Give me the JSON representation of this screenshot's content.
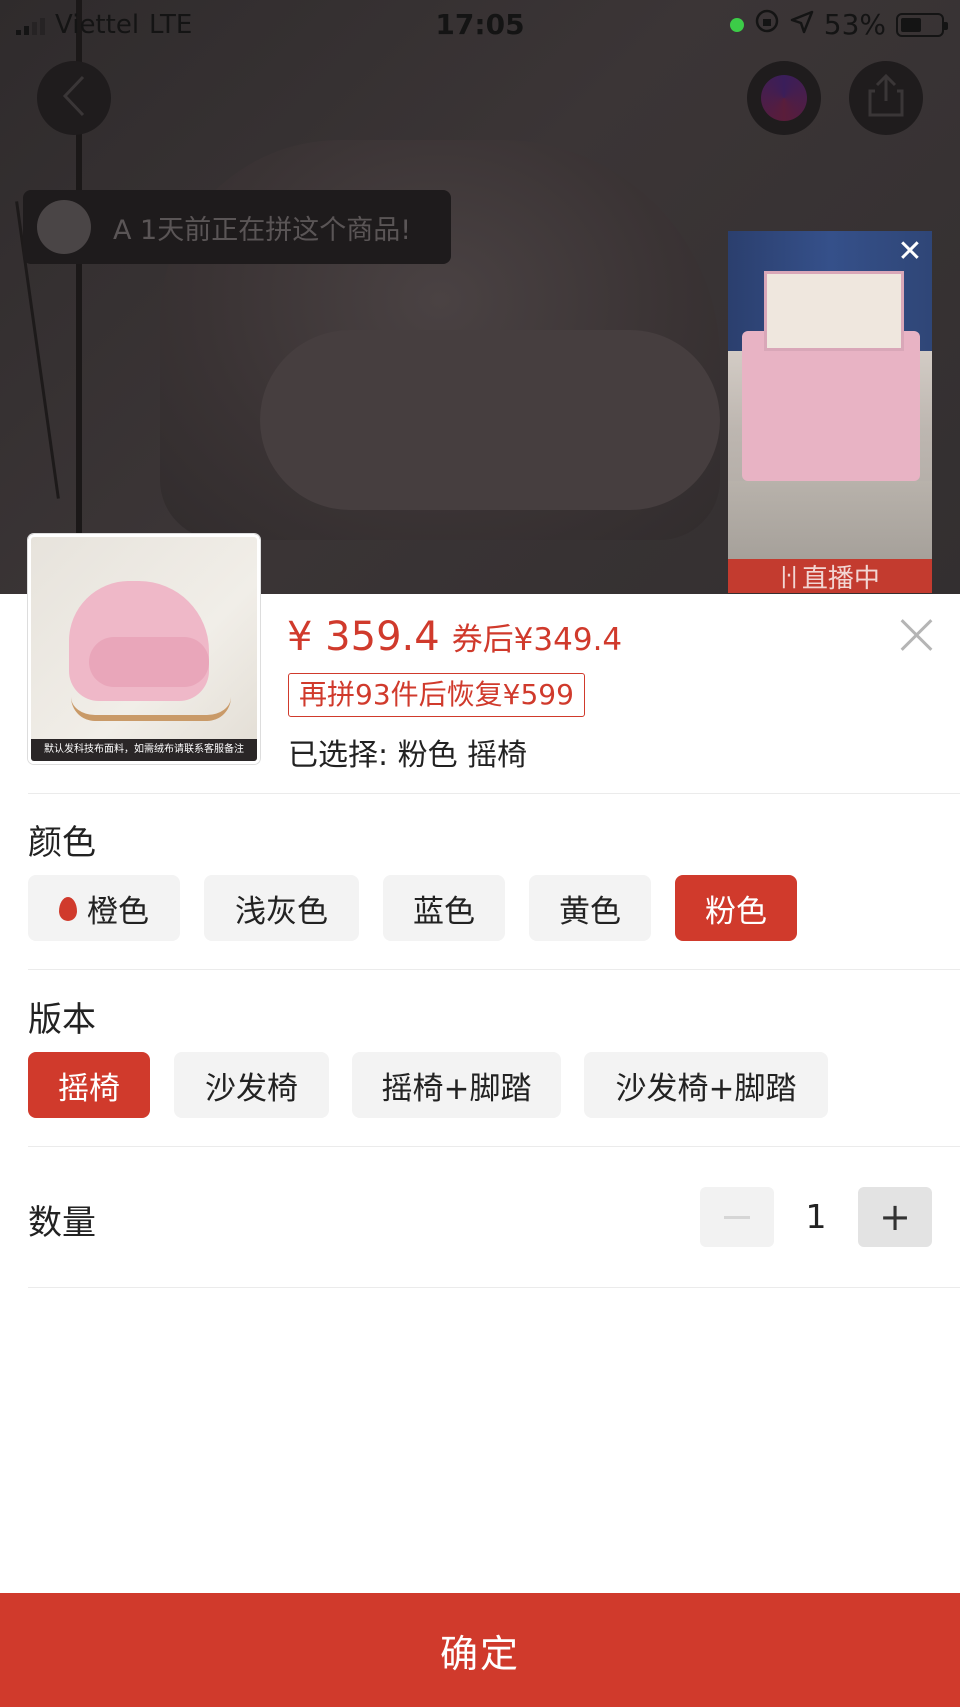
{
  "status_bar": {
    "carrier": "Viettel",
    "network": "LTE",
    "time": "17:05",
    "battery_percent": "53%",
    "battery_level": 0.53
  },
  "icons": {
    "back": "chevron-left-icon",
    "share": "share-icon",
    "close": "close-icon",
    "flame": "flame-icon"
  },
  "notice": {
    "text": "A 1天前正在拼这个商品!"
  },
  "live": {
    "label": "直播中"
  },
  "product": {
    "thumb_caption": "默认发科技布面料，如需绒布请联系客服备注",
    "price": "¥ 359.4",
    "coupon_price": "券后¥349.4",
    "restore_notice": "再拼93件后恢复¥599",
    "selected": "已选择: 粉色 摇椅"
  },
  "color_section": {
    "title": "颜色",
    "options": [
      {
        "label": "橙色",
        "selected": false,
        "hot": true
      },
      {
        "label": "浅灰色",
        "selected": false
      },
      {
        "label": "蓝色",
        "selected": false
      },
      {
        "label": "黄色",
        "selected": false
      },
      {
        "label": "粉色",
        "selected": true
      }
    ]
  },
  "version_section": {
    "title": "版本",
    "options": [
      {
        "label": "摇椅",
        "selected": true
      },
      {
        "label": "沙发椅",
        "selected": false
      },
      {
        "label": "摇椅+脚踏",
        "selected": false
      },
      {
        "label": "沙发椅+脚踏",
        "selected": false
      }
    ]
  },
  "quantity": {
    "label": "数量",
    "value": "1",
    "minus": "−",
    "plus": "+"
  },
  "confirm_label": "确定",
  "colors": {
    "accent": "#d03a2c",
    "option_bg": "#f3f3f3",
    "dim_overlay": "#332f30"
  }
}
